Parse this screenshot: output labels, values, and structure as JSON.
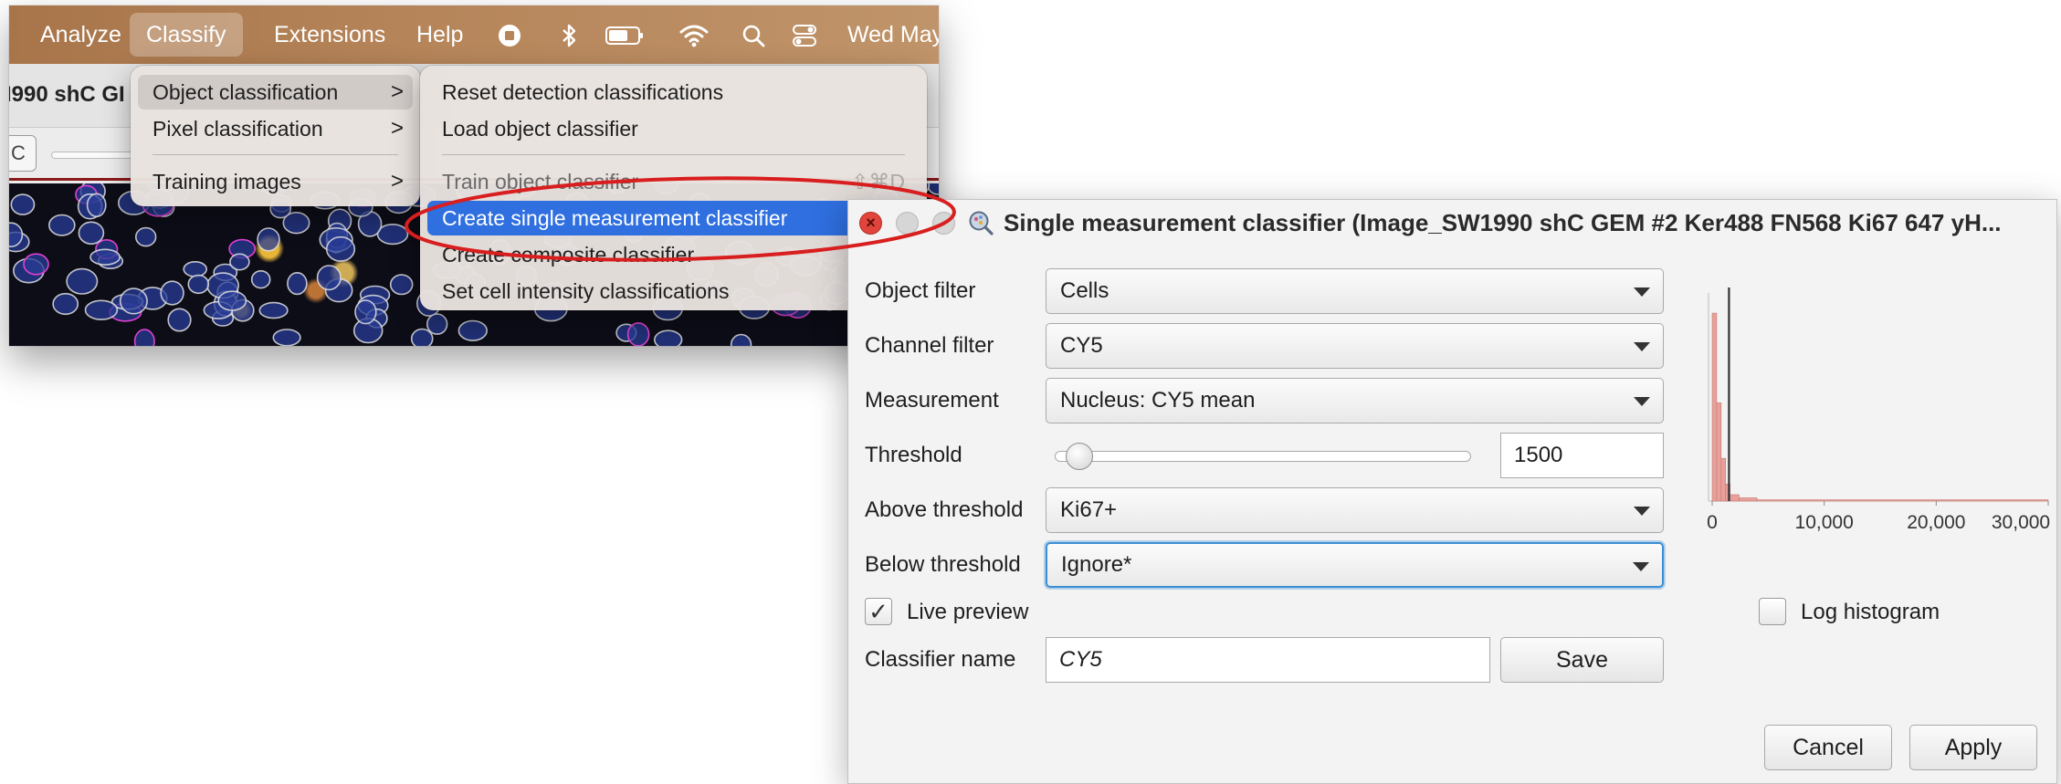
{
  "menubar": {
    "items": [
      {
        "label": "Analyze"
      },
      {
        "label": "Classify"
      },
      {
        "label": "Extensions"
      },
      {
        "label": "Help"
      }
    ],
    "clock": "Wed May",
    "status_icons": [
      "record-icon",
      "bluetooth-icon",
      "battery-icon",
      "wifi-icon",
      "search-icon",
      "control-center-icon"
    ]
  },
  "image_window": {
    "title": "I990 shC GI",
    "toolbar_button": "C"
  },
  "classify_menu": {
    "items": [
      {
        "label": "Object classification",
        "chevron": ">"
      },
      {
        "label": "Pixel classification",
        "chevron": ">"
      },
      {
        "label": "Training images",
        "chevron": ">"
      }
    ]
  },
  "object_submenu": {
    "items": [
      {
        "label": "Reset detection classifications"
      },
      {
        "label": "Load object classifier"
      },
      {
        "label": "Train object classifier",
        "shortcut": "⇧⌘D"
      },
      {
        "label": "Create single measurement classifier"
      },
      {
        "label": "Create composite classifier"
      },
      {
        "label": "Set cell intensity classifications"
      }
    ]
  },
  "dialog": {
    "title": "Single measurement classifier (Image_SW1990 shC GEM #2 Ker488 FN568 Ki67 647 yH...",
    "close_symbol": "×",
    "object_filter": {
      "label": "Object filter",
      "value": "Cells"
    },
    "channel_filter": {
      "label": "Channel filter",
      "value": "CY5"
    },
    "measurement": {
      "label": "Measurement",
      "value": "Nucleus: CY5 mean"
    },
    "threshold": {
      "label": "Threshold",
      "value": "1500"
    },
    "above_threshold": {
      "label": "Above threshold",
      "value": "Ki67+"
    },
    "below_threshold": {
      "label": "Below threshold",
      "value": "Ignore*"
    },
    "live_preview": {
      "label": "Live preview",
      "checked": true,
      "check_symbol": "✓"
    },
    "log_histogram": {
      "label": "Log histogram",
      "checked": false
    },
    "classifier_name": {
      "label": "Classifier name",
      "value": "CY5"
    },
    "save_label": "Save",
    "cancel_label": "Cancel",
    "apply_label": "Apply",
    "histogram": {
      "x_ticks": [
        "0",
        "10,000",
        "20,000",
        "30,000"
      ],
      "x_range": [
        0,
        30000
      ],
      "threshold_value": 1500,
      "bar_color": "#e8a09a"
    }
  },
  "colors": {
    "accent_selected": "#2f6fe0",
    "annotation_ellipse": "#d81e1e",
    "close_button": "#e0443a",
    "menubar": "#b6855a"
  }
}
